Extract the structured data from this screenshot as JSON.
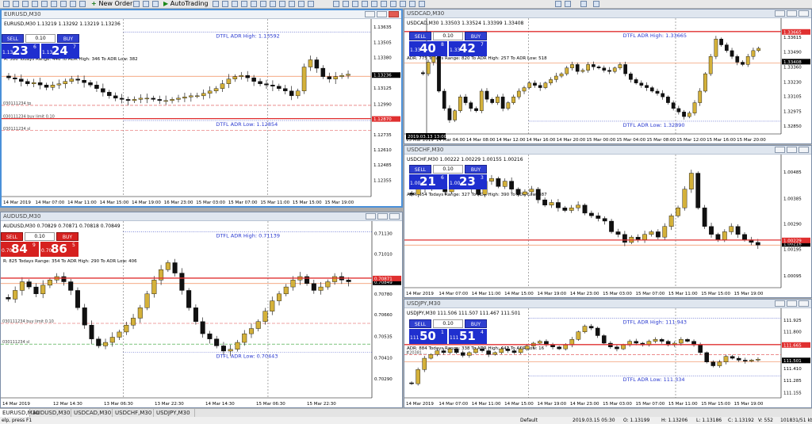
{
  "toolbar": {
    "new_order": "New Order",
    "autotrading": "AutoTrading"
  },
  "colors": {
    "bull": "#d4b13a",
    "bear": "#111111",
    "adr_high": "#e03030",
    "adr_low": "#e03030",
    "ref_line": "#f08c5a"
  },
  "charts": [
    {
      "id": "eurusd",
      "title": "EURUSD,M30",
      "info": "EURUSD,M30  1.13219 1.13292 1.13219 1.13236",
      "adr": "R: 586  Todays Range: 446  To ADR High: 346  To ADR Low: 382",
      "panel": {
        "color": "blue",
        "sell": "SELL",
        "buy": "BUY",
        "lot": "0.10",
        "bid_small": "1.13",
        "bid_big": "23",
        "bid_pip": "6",
        "ask_small": "1.13",
        "ask_big": "24",
        "ask_pip": "7"
      },
      "ylim": [
        1.1222,
        1.137
      ],
      "yticks": [
        "1.13635",
        "1.13505",
        "1.13380",
        "1.13236",
        "1.13125",
        "1.12990",
        "1.12870",
        "1.12735",
        "1.12610",
        "1.12485",
        "1.12355",
        "1.12230"
      ],
      "xticks": [
        "14 Mar 2019",
        "14 Mar 07:00",
        "14 Mar 11:00",
        "14 Mar 15:00",
        "14 Mar 19:00",
        "16 Mar 23:00",
        "15 Mar 03:00",
        "15 Mar 07:00",
        "15 Mar 11:00",
        "15 Mar 15:00",
        "15 Mar 19:00"
      ],
      "price": "1.13236",
      "price_value": 1.13236,
      "adr_high": {
        "label": "DTFL ADR High: 1.13592",
        "value": 1.13592
      },
      "adr_low": {
        "label": "DTFL ADR Low: 1.12854",
        "value": 1.12854
      },
      "order_lines": [
        {
          "label": "030111234 tp",
          "value": 1.1298
        },
        {
          "label": "030111234 buy limit 0.10",
          "value": 1.1287
        },
        {
          "label": "030111234 sl",
          "value": 1.1277
        }
      ],
      "red_tag": "1.12870",
      "closes": [
        1.1321,
        1.132,
        1.1318,
        1.1316,
        1.1317,
        1.1315,
        1.1313,
        1.1315,
        1.1316,
        1.1318,
        1.132,
        1.1319,
        1.1317,
        1.1315,
        1.1312,
        1.1309,
        1.1306,
        1.1304,
        1.1303,
        1.1302,
        1.1303,
        1.1304,
        1.1304,
        1.1303,
        1.1302,
        1.1302,
        1.1303,
        1.1304,
        1.1305,
        1.1306,
        1.1306,
        1.1308,
        1.131,
        1.1312,
        1.1316,
        1.132,
        1.1322,
        1.1323,
        1.1321,
        1.1318,
        1.1316,
        1.1315,
        1.1314,
        1.1312,
        1.131,
        1.1306,
        1.131,
        1.133,
        1.1336,
        1.1329,
        1.1322,
        1.132,
        1.1322,
        1.1323,
        1.1324
      ]
    },
    {
      "id": "usdcad",
      "title": "USDCAD,M30",
      "info": "USDCAD,M30  1.33503 1.33524 1.33399 1.33408",
      "adr": "ADR: 775  Todays Range: 820  To ADR High: 257  To ADR Low: 518",
      "panel": {
        "color": "blue",
        "sell": "SELL",
        "buy": "BUY",
        "lot": "0.10",
        "bid_small": "1.33",
        "bid_big": "40",
        "bid_pip": "8",
        "ask_small": "1.33",
        "ask_big": "42",
        "ask_pip": "7"
      },
      "ylim": [
        1.3278,
        1.3378
      ],
      "yticks": [
        "1.33615",
        "1.33490",
        "1.33408",
        "1.33360",
        "1.33230",
        "1.33105",
        "1.32975",
        "1.32850"
      ],
      "xticks": [
        "13 Mar 2019",
        "14 Mar 04:00",
        "14 Mar 08:00",
        "14 Mar 12:00",
        "14 Mar 16:00",
        "14 Mar 20:00",
        "15 Mar 00:00",
        "15 Mar 04:00",
        "15 Mar 08:00",
        "15 Mar 12:00",
        "15 Mar 16:00",
        "15 Mar 20:00"
      ],
      "price": "1.33408",
      "price_value": 1.33408,
      "adr_high": {
        "label": "DTFL ADR High: 1.33665",
        "value": 1.33665
      },
      "adr_low": {
        "label": "DTFL ADR Low: 1.32890",
        "value": 1.3289
      },
      "order_lines": [],
      "red_tag": "1.33665",
      "cursor_label": "2019.03.13 13:00",
      "closes": [
        1.333,
        1.334,
        1.3345,
        1.3315,
        1.33,
        1.329,
        1.3298,
        1.331,
        1.3305,
        1.33,
        1.3298,
        1.3315,
        1.3308,
        1.3305,
        1.331,
        1.33,
        1.3305,
        1.331,
        1.3315,
        1.3318,
        1.3322,
        1.332,
        1.3318,
        1.3322,
        1.3325,
        1.3328,
        1.333,
        1.3335,
        1.3338,
        1.3332,
        1.3333,
        1.3338,
        1.3336,
        1.3335,
        1.3333,
        1.3332,
        1.3335,
        1.3338,
        1.333,
        1.3325,
        1.3322,
        1.332,
        1.3318,
        1.3315,
        1.3313,
        1.331,
        1.3305,
        1.33,
        1.3297,
        1.3293,
        1.3296,
        1.3305,
        1.3315,
        1.333,
        1.3345,
        1.336,
        1.3355,
        1.335,
        1.3345,
        1.334,
        1.3338,
        1.3345,
        1.335,
        1.3352
      ]
    },
    {
      "id": "usdchf",
      "title": "USDCHF,M30",
      "info": "USDCHF,M30  1.00222 1.00229 1.00155 1.00216",
      "adr": "ADR: 654  Todays Range: 327  To ADR High: 390  To ADR Low: 387",
      "panel": {
        "color": "blue",
        "sell": "SELL",
        "buy": "BUY",
        "lot": "0.10",
        "bid_small": "1.00",
        "bid_big": "21",
        "bid_pip": "6",
        "ask_small": "1.00",
        "ask_big": "23",
        "ask_pip": "3"
      },
      "ylim": [
        1.0005,
        1.0055
      ],
      "yticks": [
        "1.00485",
        "1.00385",
        "1.00290",
        "1.00216",
        "1.00195",
        "1.00095"
      ],
      "xticks": [
        "14 Mar 2019",
        "14 Mar 07:00",
        "14 Mar 11:00",
        "14 Mar 15:00",
        "14 Mar 19:00",
        "14 Mar 23:00",
        "15 Mar 03:00",
        "15 Mar 07:00",
        "15 Mar 11:00",
        "15 Mar 15:00",
        "15 Mar 19:00"
      ],
      "price": "1.00216",
      "price_value": 1.00216,
      "adr_high": null,
      "adr_low": null,
      "order_lines": [],
      "red_tag": "1.00229",
      "closes": [
        1.004,
        1.0045,
        1.0042,
        1.0044,
        1.0043,
        1.0041,
        1.0043,
        1.0045,
        1.0044,
        1.0042,
        1.004,
        1.0045,
        1.0046,
        1.0043,
        1.0045,
        1.0042,
        1.004,
        1.0041,
        1.0042,
        1.0038,
        1.0036,
        1.0037,
        1.0035,
        1.0034,
        1.0035,
        1.0036,
        1.0033,
        1.0032,
        1.0031,
        1.003,
        1.0026,
        1.0025,
        1.0022,
        1.0024,
        1.0023,
        1.0025,
        1.0026,
        1.0024,
        1.0028,
        1.0032,
        1.0035,
        1.0042,
        1.0048,
        1.0035,
        1.0028,
        1.0025,
        1.0023,
        1.0026,
        1.0028,
        1.0025,
        1.0023,
        1.0022,
        1.0021
      ]
    },
    {
      "id": "audusd",
      "title": "AUDUSD,M30",
      "info": "AUDUSD,M30  0.70829 0.70871 0.70818 0.70849",
      "adr": "R: 825  Todays Range: 354  To ADR High: 290  To ADR Low: 406",
      "panel": {
        "color": "red",
        "sell": "SELL",
        "buy": "BUY",
        "lot": "0.10",
        "bid_small": "0.70",
        "bid_big": "84",
        "bid_pip": "9",
        "ask_small": "0.70",
        "ask_big": "86",
        "ask_pip": "5"
      },
      "ylim": [
        0.7018,
        0.712
      ],
      "yticks": [
        "0.71130",
        "0.71010",
        "0.70849",
        "0.70780",
        "0.70660",
        "0.70535",
        "0.70410",
        "0.70290",
        "0.70170",
        "0.70050",
        "0.69930"
      ],
      "xticks": [
        "14 Mar 2019",
        "12 Mar 14:30",
        "13 Mar 06:30",
        "13 Mar 22:30",
        "14 Mar 14:30",
        "15 Mar 06:30",
        "15 Mar 22:30"
      ],
      "price": "0.70849",
      "price_value": 0.70849,
      "adr_high": {
        "label": "DTFL ADR High: 0.71139",
        "value": 0.71139
      },
      "adr_low": {
        "label": "DTFL ADR Low: 0.70443",
        "value": 0.70443
      },
      "order_lines": [
        {
          "label": "030111234 buy limit 0.10",
          "value": 0.7061
        },
        {
          "label": "030111234 sl",
          "value": 0.7049
        }
      ],
      "red_tag": "0.70871",
      "closes": [
        0.7075,
        0.708,
        0.7085,
        0.7082,
        0.7078,
        0.7083,
        0.7086,
        0.7088,
        0.7085,
        0.708,
        0.707,
        0.706,
        0.7052,
        0.7048,
        0.705,
        0.7053,
        0.7056,
        0.706,
        0.7064,
        0.707,
        0.7078,
        0.7086,
        0.7092,
        0.7096,
        0.709,
        0.708,
        0.707,
        0.7062,
        0.7055,
        0.7052,
        0.7048,
        0.7045,
        0.7046,
        0.705,
        0.7055,
        0.7058,
        0.7062,
        0.7068,
        0.7074,
        0.7078,
        0.7082,
        0.7086,
        0.7088,
        0.7084,
        0.708,
        0.7082,
        0.7085,
        0.7088,
        0.7086,
        0.7085
      ]
    },
    {
      "id": "usdjpy",
      "title": "USDJPY,M30",
      "info": "USDJPY,M30  111.506 111.507 111.467 111.501",
      "adr": "ADR: 884  Todays Range: 338  To ADR High: 442  To ADR Low: 16",
      "panel": {
        "color": "blue",
        "sell": "SELL",
        "buy": "BUY",
        "lot": "0.10",
        "bid_small": "111",
        "bid_big": "50",
        "bid_pip": "1",
        "ask_small": "111",
        "ask_big": "51",
        "ask_pip": "4"
      },
      "ylim": [
        111.1,
        112.05
      ],
      "yticks": [
        "111.925",
        "111.800",
        "111.665",
        "111.501",
        "111.410",
        "111.285",
        "111.155"
      ],
      "xticks": [
        "14 Mar 2019",
        "14 Mar 07:00",
        "14 Mar 11:00",
        "14 Mar 15:00",
        "14 Mar 19:00",
        "14 Mar 23:00",
        "15 Mar 03:00",
        "15 Mar 07:00",
        "15 Mar 11:00",
        "15 Mar 15:00",
        "15 Mar 19:00"
      ],
      "price": "111.501",
      "price_value": 111.501,
      "adr_high": {
        "label": "DTFL ADR High: 111.943",
        "value": 111.943
      },
      "adr_low": {
        "label": "DTFL ADR Low: 111.334",
        "value": 111.334
      },
      "order_lines": [
        {
          "label": "#20381 ...",
          "value": 111.56
        }
      ],
      "red_tag": "111.665",
      "closes": [
        111.25,
        111.4,
        111.52,
        111.56,
        111.6,
        111.58,
        111.62,
        111.58,
        111.55,
        111.58,
        111.62,
        111.6,
        111.56,
        111.58,
        111.62,
        111.6,
        111.58,
        111.62,
        111.65,
        111.68,
        111.7,
        111.66,
        111.64,
        111.62,
        111.66,
        111.72,
        111.8,
        111.86,
        111.84,
        111.76,
        111.68,
        111.64,
        111.62,
        111.66,
        111.7,
        111.68,
        111.66,
        111.7,
        111.72,
        111.7,
        111.66,
        111.68,
        111.72,
        111.7,
        111.66,
        111.58,
        111.48,
        111.44,
        111.48,
        111.54,
        111.52,
        111.5,
        111.49,
        111.5,
        111.51
      ]
    }
  ],
  "tabs": [
    "EURUSD,M30",
    "AUDUSD,M30",
    "USDCAD,M30",
    "USDCHF,M30",
    "USDJPY,M30"
  ],
  "status": {
    "help": "elp, press F1",
    "profile": "Default",
    "time": "2019.03.15 05:30",
    "o": "O: 1.13199",
    "h": "H: 1.13206",
    "l": "L: 1.13186",
    "c": "C: 1.13192",
    "v": "V: 552",
    "traffic": "101831/51 kb"
  }
}
